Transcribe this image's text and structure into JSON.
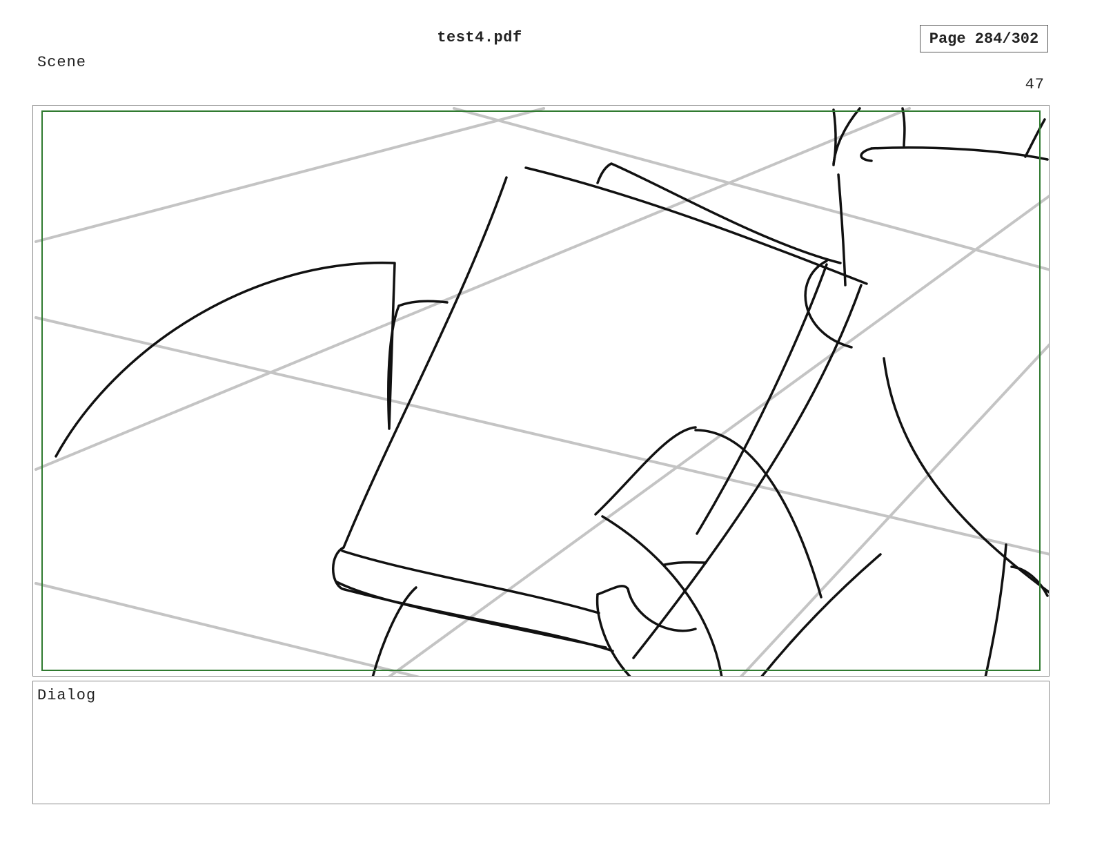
{
  "header": {
    "document_title": "test4.pdf",
    "page_indicator": "Page 284/302"
  },
  "panel": {
    "scene_label": "Scene",
    "panel_number": "47",
    "safe_area_color": "#2f7a2f",
    "sketch_stroke_color": "#111111",
    "guide_line_color": "#c4c4c4"
  },
  "dialog": {
    "label": "Dialog"
  }
}
